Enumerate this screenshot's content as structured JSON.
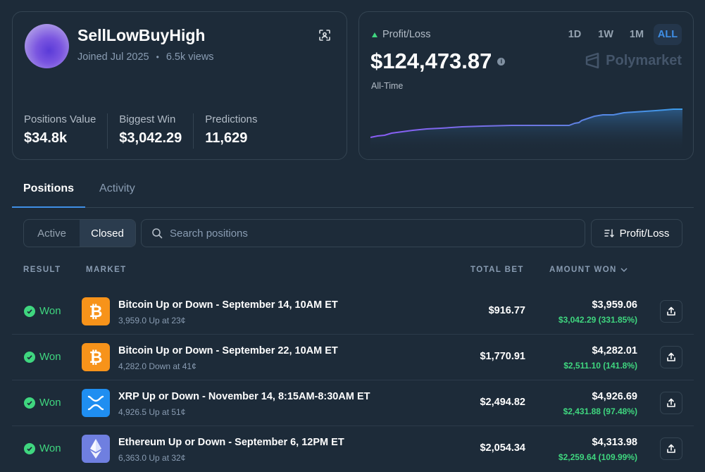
{
  "profile": {
    "username": "SellLowBuyHigh",
    "joined": "Joined Jul 2025",
    "separator": "•",
    "views": "6.5k views",
    "stats": [
      {
        "label": "Positions Value",
        "value": "$34.8k"
      },
      {
        "label": "Biggest Win",
        "value": "$3,042.29"
      },
      {
        "label": "Predictions",
        "value": "11,629"
      }
    ]
  },
  "pnl": {
    "title": "Profit/Loss",
    "value": "$124,473.87",
    "period": "All-Time",
    "brand": "Polymarket",
    "ranges": [
      "1D",
      "1W",
      "1M",
      "ALL"
    ],
    "active_range": "ALL",
    "colors": {
      "up": "#3fd67f",
      "line_start": "#8b5cf6",
      "line_end": "#3b9be8"
    }
  },
  "tabs": [
    {
      "label": "Positions",
      "active": true
    },
    {
      "label": "Activity",
      "active": false
    }
  ],
  "filters": {
    "toggle": [
      {
        "label": "Active",
        "active": false
      },
      {
        "label": "Closed",
        "active": true
      }
    ],
    "search_placeholder": "Search positions",
    "sort_label": "Profit/Loss"
  },
  "table": {
    "headers": {
      "result": "RESULT",
      "market": "MARKET",
      "total_bet": "TOTAL BET",
      "amount_won": "AMOUNT WON"
    },
    "rows": [
      {
        "result": "Won",
        "icon": "bitcoin-icon",
        "title": "Bitcoin Up or Down - September 14, 10AM ET",
        "detail": "3,959.0 Up at 23¢",
        "bet": "$916.77",
        "won": "$3,959.06",
        "gain": "$3,042.29 (331.85%)"
      },
      {
        "result": "Won",
        "icon": "bitcoin-icon",
        "title": "Bitcoin Up or Down - September 22, 10AM ET",
        "detail": "4,282.0 Down at 41¢",
        "bet": "$1,770.91",
        "won": "$4,282.01",
        "gain": "$2,511.10 (141.8%)"
      },
      {
        "result": "Won",
        "icon": "xrp-icon",
        "title": "XRP Up or Down - November 14, 8:15AM-8:30AM ET",
        "detail": "4,926.5 Up at 51¢",
        "bet": "$2,494.82",
        "won": "$4,926.69",
        "gain": "$2,431.88 (97.48%)"
      },
      {
        "result": "Won",
        "icon": "ethereum-icon",
        "title": "Ethereum Up or Down - September 6, 12PM ET",
        "detail": "6,363.0 Up at 32¢",
        "bet": "$2,054.34",
        "won": "$4,313.98",
        "gain": "$2,259.64 (109.99%)"
      }
    ]
  }
}
